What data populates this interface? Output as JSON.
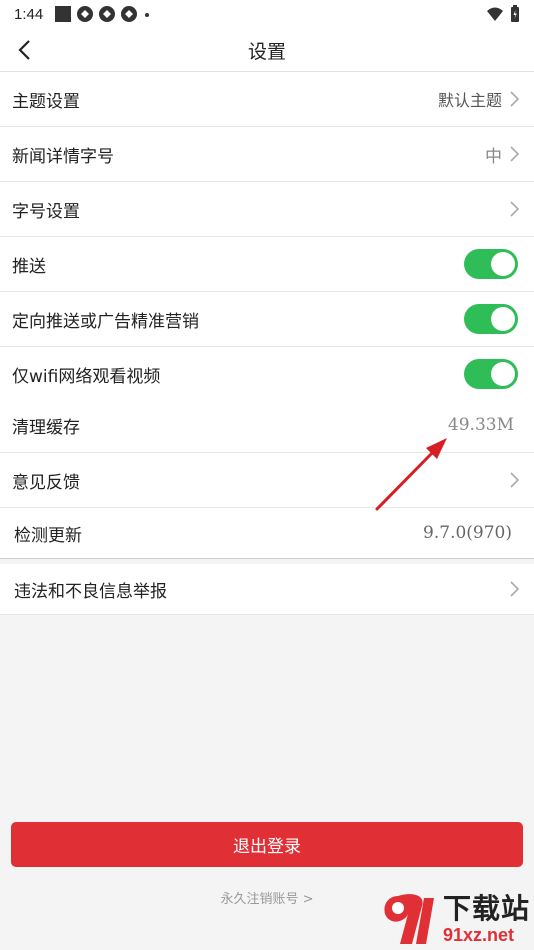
{
  "status_bar": {
    "time": "1:44"
  },
  "header": {
    "title": "设置"
  },
  "groups": [
    {
      "rows": [
        {
          "label": "主题设置",
          "value": "默认主题"
        },
        {
          "label": "新闻详情字号",
          "value": "中"
        },
        {
          "label": "字号设置"
        },
        {
          "label": "推送"
        },
        {
          "label": "定向推送或广告精准营销"
        },
        {
          "label": "仅wifi网络观看视频"
        }
      ]
    },
    {
      "rows": [
        {
          "label": "清理缓存",
          "value": "49.33M"
        },
        {
          "label": "意见反馈"
        },
        {
          "label": "检测更新",
          "value": "9.7.0(970)"
        }
      ]
    },
    {
      "rows": [
        {
          "label": "违法和不良信息举报"
        }
      ]
    }
  ],
  "toggles": {
    "push": true,
    "targeted_ads": true,
    "wifi_only_video": true
  },
  "logout": {
    "label": "退出登录"
  },
  "cancel_account": {
    "label": "永久注销账号 >"
  },
  "watermark": {
    "cn": "下载站",
    "en": "91xz.net"
  },
  "colors": {
    "accent_red": "#e02f35",
    "toggle_on": "#2fbd57"
  },
  "icons": [
    "back-arrow-icon",
    "chevron-right-icon",
    "wifi-icon",
    "battery-icon"
  ]
}
